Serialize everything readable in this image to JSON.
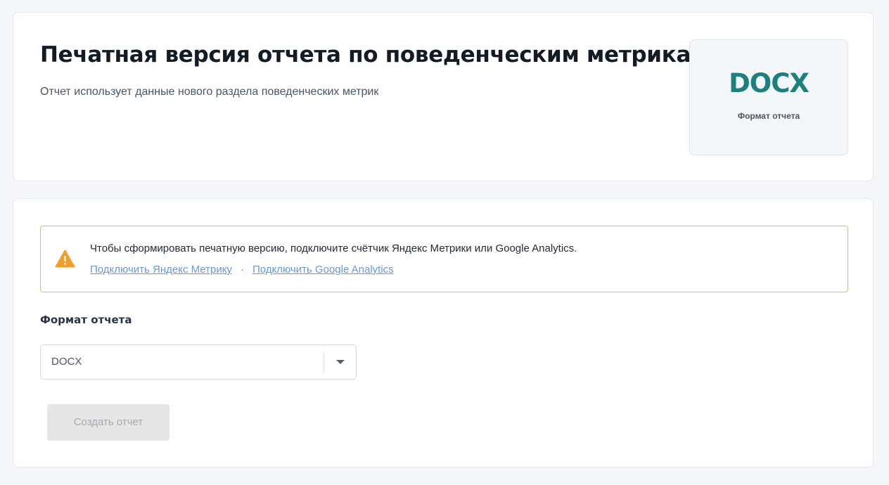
{
  "header": {
    "title": "Печатная версия отчета по поведенческим метрикам",
    "subtitle": "Отчет использует данные нового раздела поведенческих метрик",
    "format_badge": {
      "value": "DOCX",
      "caption": "Формат отчета",
      "value_color": "#1f7f7f"
    }
  },
  "alert": {
    "icon": "warning-triangle-icon",
    "icon_color": "#f0a02a",
    "border_color": "#eeba4e",
    "message": "Чтобы сформировать печатную версию, подключите счётчик Яндекс Метрики или Google Analytics.",
    "links": [
      {
        "label": "Подключить Яндекс Метрику"
      },
      {
        "label": "Подключить Google Analytics"
      }
    ],
    "separator": "·",
    "link_color": "#6d95d6"
  },
  "form": {
    "format_label": "Формат отчета",
    "format_select": {
      "value": "DOCX",
      "icon": "caret-down-icon"
    },
    "submit_label": "Создать отчет",
    "submit_disabled": true
  }
}
